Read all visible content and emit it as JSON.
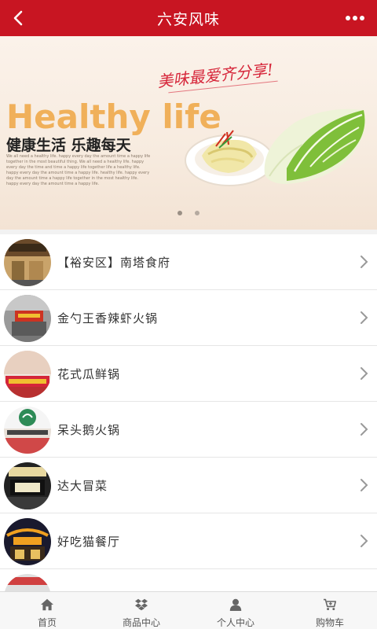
{
  "header": {
    "title": "六安风味",
    "back_icon": "chevron-left-icon",
    "more_icon": "ellipsis-icon"
  },
  "banner": {
    "headline": "Healthy life",
    "subline": "健康生活 乐趣每天",
    "slogan": "美味最爱齐分享!",
    "fineprint": "We all need a healthy life. happy every day the amount time a happy life together in the most beautiful thing. We all need a healthy life. happy every day the time and time a happy life together life a healthy life. happy every day the amount time a happy life. healthy life. happy every day the amount time a happy life together in the most healthy life. happy every day the amount time a happy life.",
    "slides_total": 2,
    "slide_active": 1
  },
  "list": [
    {
      "name": "【裕安区】南塔食府",
      "thumb_colors": [
        "#6a4a2a",
        "#c9a36a"
      ]
    },
    {
      "name": "金勺王香辣虾火锅",
      "thumb_colors": [
        "#8c8c8c",
        "#cc3322"
      ]
    },
    {
      "name": "花式瓜鲜锅",
      "thumb_colors": [
        "#d4263a",
        "#f0c030"
      ]
    },
    {
      "name": "呆头鹅火锅",
      "thumb_colors": [
        "#2e8b57",
        "#f5f5f5"
      ]
    },
    {
      "name": "达大冒菜",
      "thumb_colors": [
        "#222222",
        "#e8d8a0"
      ]
    },
    {
      "name": "好吃猫餐厅",
      "thumb_colors": [
        "#1a1a2e",
        "#f0a020"
      ]
    },
    {
      "name": "",
      "thumb_colors": [
        "#d04040",
        "#e0e0e0"
      ]
    }
  ],
  "tabbar": [
    {
      "label": "首页",
      "icon": "home-icon"
    },
    {
      "label": "商品中心",
      "icon": "dropbox-icon"
    },
    {
      "label": "个人中心",
      "icon": "user-icon"
    },
    {
      "label": "购物车",
      "icon": "cart-icon"
    }
  ],
  "colors": {
    "brand": "#c81522",
    "text": "#333333",
    "chevron": "#999999"
  }
}
